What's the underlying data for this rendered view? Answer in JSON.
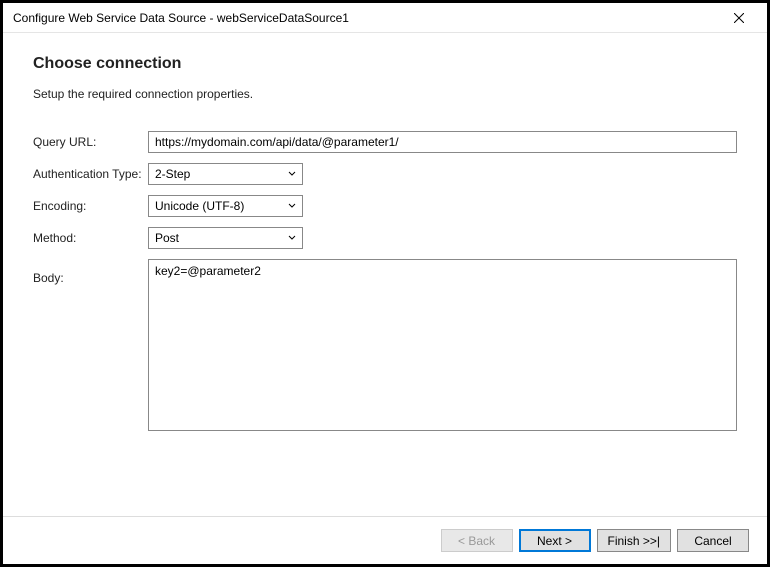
{
  "titlebar": {
    "title": "Configure Web Service Data Source - webServiceDataSource1"
  },
  "content": {
    "heading": "Choose connection",
    "subheading": "Setup the required connection properties."
  },
  "form": {
    "queryUrl": {
      "label": "Query URL:",
      "value": "https://mydomain.com/api/data/@parameter1/"
    },
    "authType": {
      "label": "Authentication Type:",
      "value": "2-Step"
    },
    "encoding": {
      "label": "Encoding:",
      "value": "Unicode (UTF-8)"
    },
    "method": {
      "label": "Method:",
      "value": "Post"
    },
    "body": {
      "label": "Body:",
      "value": "key2=@parameter2"
    }
  },
  "footer": {
    "back": "< Back",
    "next": "Next >",
    "finish": "Finish >>|",
    "cancel": "Cancel"
  }
}
